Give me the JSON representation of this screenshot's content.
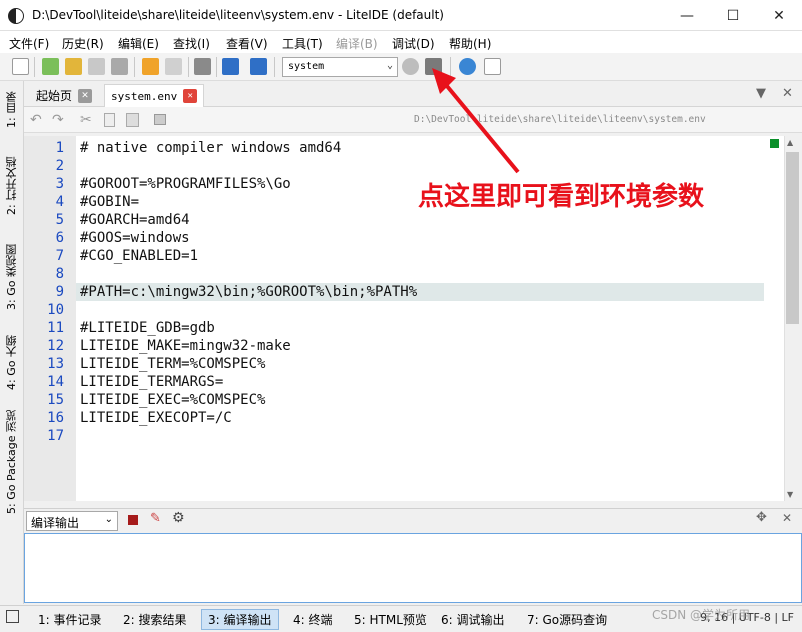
{
  "window": {
    "title": "D:\\DevTool\\liteide\\share\\liteide\\liteenv\\system.env - LiteIDE (default)",
    "minimize": "—",
    "maximize": "☐",
    "close": "✕"
  },
  "menu": [
    "文件(F)",
    "历史(R)",
    "编辑(E)",
    "查找(I)",
    "查看(V)",
    "工具(T)",
    "编译(B)",
    "调试(D)",
    "帮助(H)"
  ],
  "toolbar": {
    "env_value": "system"
  },
  "left_tabs": [
    "1: 目录",
    "2: 打开文档",
    "3: Go 类视图",
    "4: Go 大纲",
    "5: Go Package 浏览"
  ],
  "editor_tabs": [
    {
      "label": "起始页"
    },
    {
      "label": "system.env"
    }
  ],
  "path": "D:\\DevTool\\liteide\\share\\liteide\\liteenv\\system.env",
  "code_lines": [
    {
      "n": "1",
      "text": "# native compiler windows amd64"
    },
    {
      "n": "2",
      "text": ""
    },
    {
      "n": "3",
      "text": "#GOROOT=%PROGRAMFILES%\\Go"
    },
    {
      "n": "4",
      "text": "#GOBIN="
    },
    {
      "n": "5",
      "text": "#GOARCH=amd64"
    },
    {
      "n": "6",
      "text": "#GOOS=windows"
    },
    {
      "n": "7",
      "text": "#CGO_ENABLED=1"
    },
    {
      "n": "8",
      "text": ""
    },
    {
      "n": "9",
      "text": "#PATH=c:\\mingw32\\bin;%GOROOT%\\bin;%PATH%"
    },
    {
      "n": "10",
      "text": ""
    },
    {
      "n": "11",
      "text": "#LITEIDE_GDB=gdb"
    },
    {
      "n": "12",
      "text": "LITEIDE_MAKE=mingw32-make"
    },
    {
      "n": "13",
      "text": "LITEIDE_TERM=%COMSPEC%"
    },
    {
      "n": "14",
      "text": "LITEIDE_TERMARGS="
    },
    {
      "n": "15",
      "text": "LITEIDE_EXEC=%COMSPEC%"
    },
    {
      "n": "16",
      "text": "LITEIDE_EXECOPT=/C"
    },
    {
      "n": "17",
      "text": ""
    }
  ],
  "annotation": "点这里即可看到环境参数",
  "output": {
    "selected": "编译输出"
  },
  "bottom_tabs": [
    "1: 事件记录",
    "2: 搜索结果",
    "3: 编译输出",
    "4: 终端",
    "5: HTML预览",
    "6: 调试输出",
    "7: Go源码查询"
  ],
  "status": "9, 16 | UTF-8 | LF",
  "watermark": "CSDN @学为所用",
  "colors": {
    "accent": "#e8111b",
    "line_numbers": "#1a49c0",
    "current_line": "#dfe8e8",
    "active_tab": "#cfe3f6"
  }
}
